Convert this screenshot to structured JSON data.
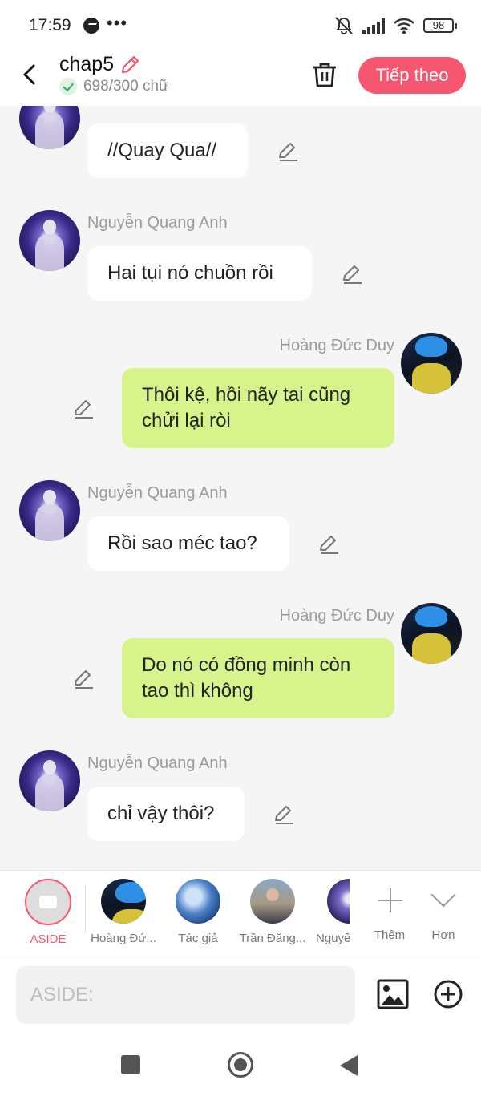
{
  "status_bar": {
    "time": "17:59",
    "dots": "•••",
    "battery": "98"
  },
  "header": {
    "title": "chap5",
    "word_count": "698/300 chữ",
    "next_label": "Tiếp theo",
    "accent_color": "#f4576f"
  },
  "messages": [
    {
      "sender": "",
      "text": "//Quay Qua//",
      "side": "left"
    },
    {
      "sender": "Nguyễn Quang Anh",
      "text": "Hai tụi nó chuồn rồi",
      "side": "left"
    },
    {
      "sender": "Hoàng Đức Duy",
      "line1": "Thôi kệ, hồi nãy tai cũng",
      "line2": "chửi lại ròi",
      "side": "right"
    },
    {
      "sender": "Nguyễn Quang Anh",
      "text": "Rồi sao méc tao?",
      "side": "left"
    },
    {
      "sender": "Hoàng Đức Duy",
      "line1": "Do nó có đồng minh còn",
      "line2": "tao thì không",
      "side": "right"
    },
    {
      "sender": "Nguyễn Quang Anh",
      "text": "chỉ vậy thôi?",
      "side": "left"
    }
  ],
  "picker": {
    "aside": "ASIDE",
    "items": [
      "Hoàng Đứ...",
      "Tác giả",
      "Trần Đăng...",
      "Nguyễ"
    ],
    "add": "Thêm",
    "more": "Hơn"
  },
  "input": {
    "placeholder": "ASIDE:"
  }
}
